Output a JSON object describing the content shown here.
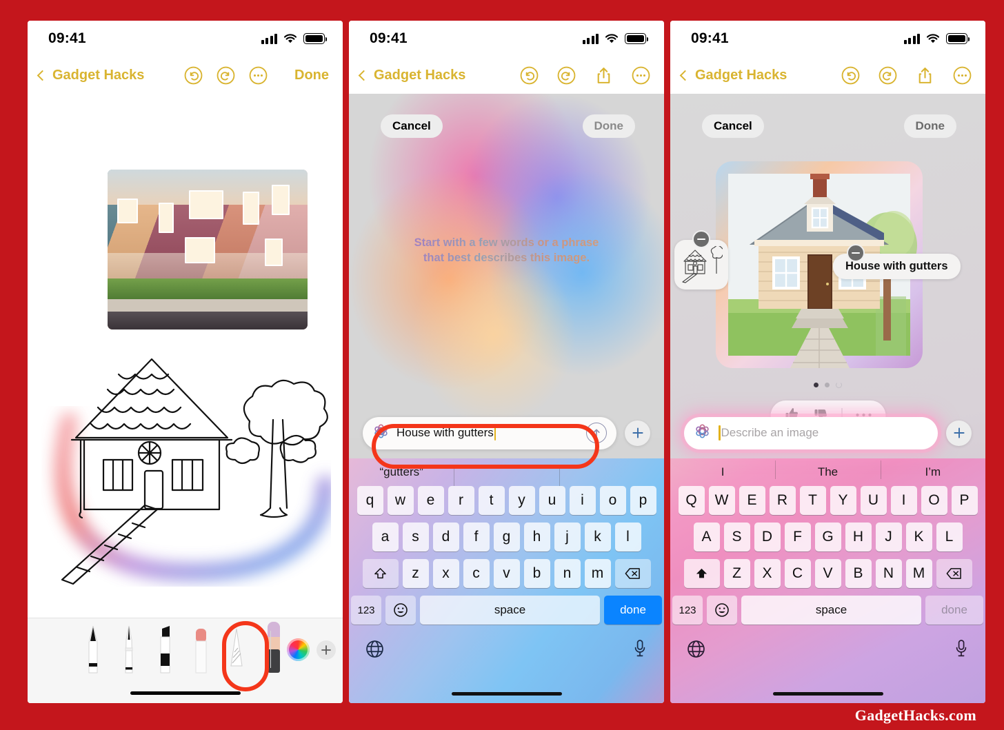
{
  "watermark": "GadgetHacks.com",
  "status_bar": {
    "time": "09:41",
    "cellular_icon": "cellular-bars-icon",
    "wifi_icon": "wifi-icon",
    "battery_icon": "battery-full-icon"
  },
  "panel1": {
    "nav": {
      "back_label": "Gadget Hacks",
      "back_icon": "chevron-left-icon",
      "undo_icon": "undo-icon",
      "redo_icon": "redo-icon",
      "more_icon": "ellipsis-circle-icon",
      "done_label": "Done"
    },
    "canvas": {
      "photo_alt": "row of colorful suburban houses at sunset",
      "sketch_alt": "hand-drawn house with thatched roof, tree and ladder"
    },
    "pencil_toolbar": {
      "tools": [
        {
          "name": "pen-tool",
          "selected": false
        },
        {
          "name": "fountain-pen-tool",
          "selected": false
        },
        {
          "name": "marker-tool",
          "selected": false
        },
        {
          "name": "eraser-tool",
          "selected": false
        },
        {
          "name": "pencil-tool",
          "selected": false
        },
        {
          "name": "image-wand-tool",
          "selected": true
        }
      ],
      "color_wheel_icon": "color-wheel-icon",
      "add_icon": "plus-icon",
      "highlight_color": "#f4361a"
    }
  },
  "panel2": {
    "nav": {
      "back_label": "Gadget Hacks",
      "undo_icon": "undo-icon",
      "redo_icon": "redo-icon",
      "share_icon": "share-icon",
      "more_icon": "ellipsis-circle-icon"
    },
    "sheet": {
      "cancel_label": "Cancel",
      "done_label": "Done",
      "done_enabled": false
    },
    "hint_line1": "Start with a few words or a phrase",
    "hint_line2": "that best describes this image.",
    "prompt": {
      "icon": "image-playground-icon",
      "value": "House with gutters",
      "send_icon": "arrow-up-circle-icon",
      "add_icon": "plus-icon",
      "highlighted": true
    },
    "keyboard": {
      "suggestions": [
        "“gutters”",
        "",
        ""
      ],
      "row1": [
        "q",
        "w",
        "e",
        "r",
        "t",
        "y",
        "u",
        "i",
        "o",
        "p"
      ],
      "row2": [
        "a",
        "s",
        "d",
        "f",
        "g",
        "h",
        "j",
        "k",
        "l"
      ],
      "row3": [
        "z",
        "x",
        "c",
        "v",
        "b",
        "n",
        "m"
      ],
      "shift_icon": "shift-icon",
      "backspace_icon": "backspace-icon",
      "numbers_label": "123",
      "emoji_icon": "emoji-icon",
      "space_label": "space",
      "return_label": "done",
      "return_enabled": true,
      "globe_icon": "globe-icon",
      "mic_icon": "microphone-icon",
      "shift_active": false
    }
  },
  "panel3": {
    "nav": {
      "back_label": "Gadget Hacks",
      "undo_icon": "undo-icon",
      "redo_icon": "redo-icon",
      "share_icon": "share-icon",
      "more_icon": "ellipsis-circle-icon"
    },
    "sheet": {
      "cancel_label": "Cancel",
      "done_label": "Done",
      "done_enabled": true
    },
    "result": {
      "image_alt": "AI illustration of a cottage with chimney, walkway and tree",
      "chips": [
        {
          "type": "sketch",
          "label": "",
          "remove_icon": "minus-circle-icon"
        },
        {
          "type": "text",
          "label": "House with gutters",
          "remove_icon": "minus-circle-icon"
        }
      ],
      "page_dots": [
        "active",
        "inactive",
        "loading"
      ],
      "feedback": {
        "like_icon": "thumbs-up-icon",
        "dislike_icon": "thumbs-down-icon",
        "more_icon": "ellipsis-icon"
      }
    },
    "prompt": {
      "icon": "image-playground-icon",
      "placeholder": "Describe an image",
      "value": "",
      "add_icon": "plus-icon"
    },
    "keyboard": {
      "suggestions": [
        "I",
        "The",
        "I’m"
      ],
      "row1": [
        "Q",
        "W",
        "E",
        "R",
        "T",
        "Y",
        "U",
        "I",
        "O",
        "P"
      ],
      "row2": [
        "A",
        "S",
        "D",
        "F",
        "G",
        "H",
        "J",
        "K",
        "L"
      ],
      "row3": [
        "Z",
        "X",
        "C",
        "V",
        "B",
        "N",
        "M"
      ],
      "shift_icon": "shift-icon",
      "backspace_icon": "backspace-icon",
      "numbers_label": "123",
      "emoji_icon": "emoji-icon",
      "space_label": "space",
      "return_label": "done",
      "return_enabled": false,
      "globe_icon": "globe-icon",
      "mic_icon": "microphone-icon",
      "shift_active": true
    }
  }
}
